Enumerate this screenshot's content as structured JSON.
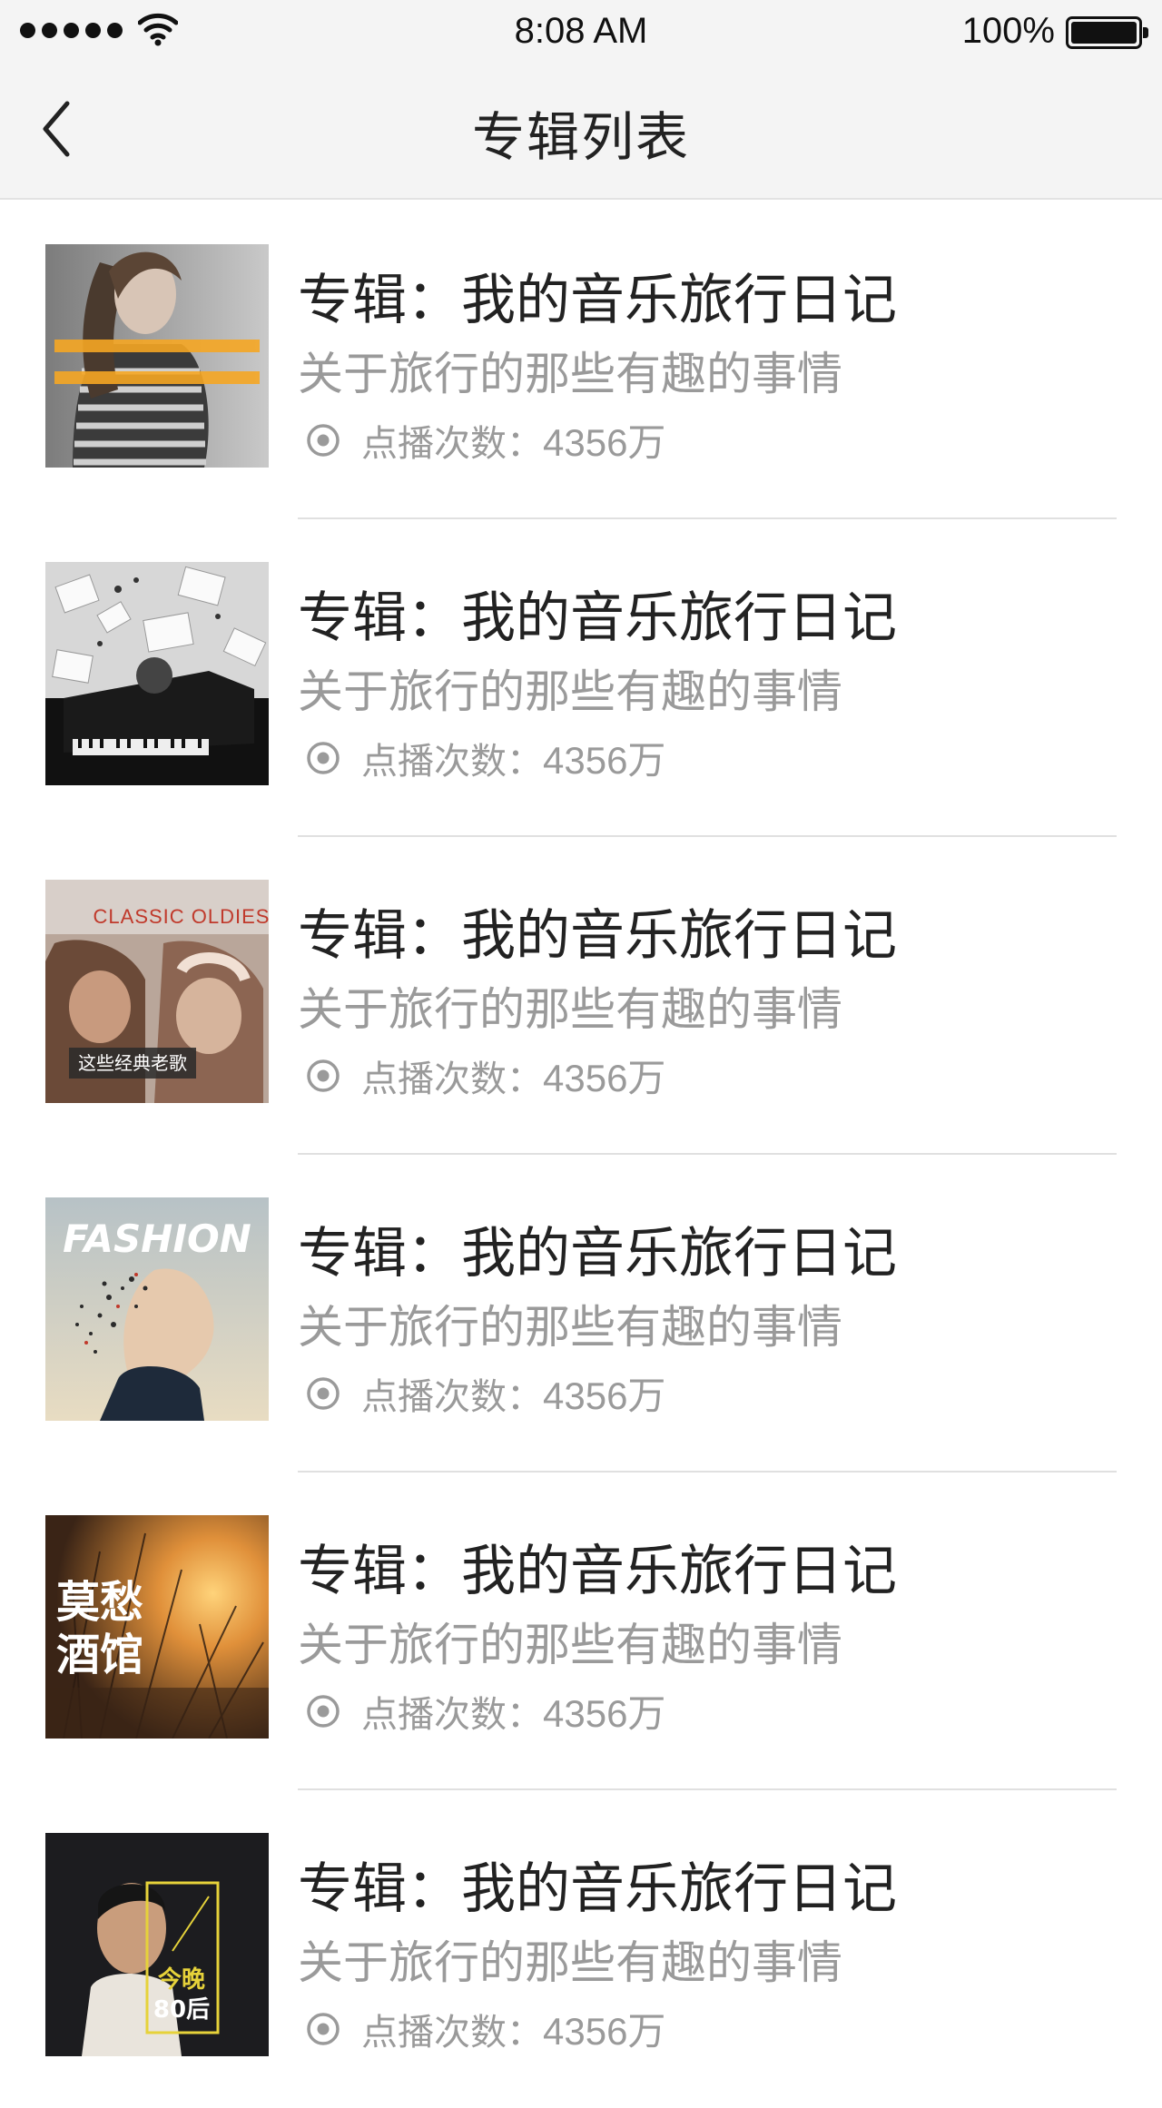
{
  "status_bar": {
    "time": "8:08 AM",
    "battery": "100%"
  },
  "nav": {
    "title": "专辑列表",
    "back_icon": "chevron-left-icon"
  },
  "albums": [
    {
      "title": "专辑：我的音乐旅行日记",
      "subtitle": "关于旅行的那些有趣的事情",
      "play_label": "点播次数：",
      "play_count": "4356万",
      "cover": "woman-portrait"
    },
    {
      "title": "专辑：我的音乐旅行日记",
      "subtitle": "关于旅行的那些有趣的事情",
      "play_label": "点播次数：",
      "play_count": "4356万",
      "cover": "piano-sheet-music"
    },
    {
      "title": "专辑：我的音乐旅行日记",
      "subtitle": "关于旅行的那些有趣的事情",
      "play_label": "点播次数：",
      "play_count": "4356万",
      "cover": "classic-oldies",
      "cover_text": [
        "CLASSIC OLDIES",
        "这些经典老歌"
      ]
    },
    {
      "title": "专辑：我的音乐旅行日记",
      "subtitle": "关于旅行的那些有趣的事情",
      "play_label": "点播次数：",
      "play_count": "4356万",
      "cover": "fashion",
      "cover_text": [
        "FASHION"
      ]
    },
    {
      "title": "专辑：我的音乐旅行日记",
      "subtitle": "关于旅行的那些有趣的事情",
      "play_label": "点播次数：",
      "play_count": "4356万",
      "cover": "sunset-grass",
      "cover_text": [
        "莫愁",
        "酒馆"
      ]
    },
    {
      "title": "专辑：我的音乐旅行日记",
      "subtitle": "关于旅行的那些有趣的事情",
      "play_label": "点播次数：",
      "play_count": "4356万",
      "cover": "man-portrait",
      "cover_text": [
        "今晚",
        "80后"
      ]
    }
  ]
}
